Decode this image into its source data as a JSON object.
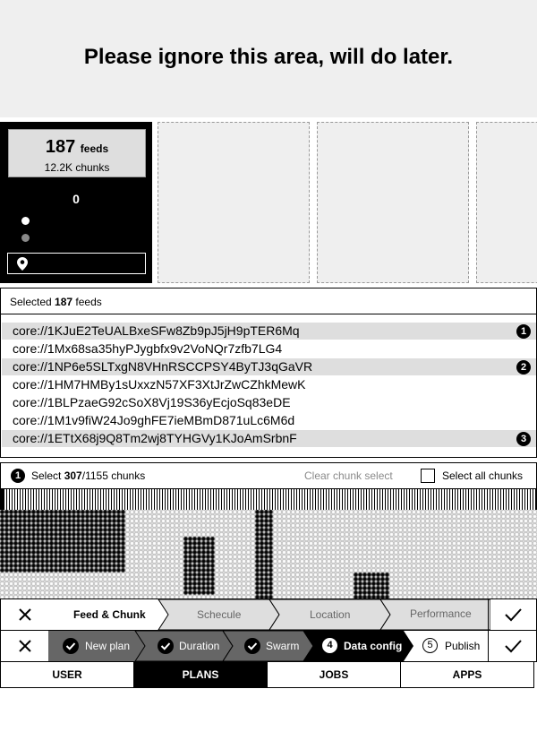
{
  "banner": {
    "text": "Please ignore this area, will do later."
  },
  "feed_summary": {
    "count": "187",
    "unit": "feeds",
    "chunks": "12.2K chunks",
    "zero_value": "0"
  },
  "selection": {
    "prefix": "Selected",
    "count": "187",
    "suffix": "feeds"
  },
  "feeds": [
    {
      "id": "core://1KJuE2TeUALBxeSFw8Zb9pJ5jH9pTER6Mq",
      "highlighted": true,
      "badge": "1"
    },
    {
      "id": "core://1Mx68sa35hyPJygbfx9v2VoNQr7zfb7LG4",
      "highlighted": false,
      "badge": ""
    },
    {
      "id": "core://1NP6e5SLTxgN8VHnRSCCPSY4ByTJ3qGaVR",
      "highlighted": true,
      "badge": "2"
    },
    {
      "id": "core://1HM7HMBy1sUxxzN57XF3XtJrZwCZhkMewK",
      "highlighted": false,
      "badge": ""
    },
    {
      "id": "core://1BLPzaeG92cSoX8Vj19S36yEcjoSq83eDE",
      "highlighted": false,
      "badge": ""
    },
    {
      "id": "core://1M1v9fiW24Jo9ghFE7ieMBmD871uLc6M6d",
      "highlighted": false,
      "badge": ""
    },
    {
      "id": "core://1ETtX68j9Q8Tm2wj8TYHGVy1KJoAmSrbnF",
      "highlighted": true,
      "badge": "3"
    }
  ],
  "chunk_select": {
    "badge": "1",
    "label": "Select",
    "selected": "307",
    "total": "/1155 chunks",
    "clear_label": "Clear chunk select",
    "select_all_label": "Select all chunks"
  },
  "steps_row1": [
    {
      "label": "Feed & Chunk",
      "state": "active"
    },
    {
      "label": "Schecule",
      "state": "upcoming"
    },
    {
      "label": "Location",
      "state": "upcoming"
    },
    {
      "label": "Performance",
      "state": "upcoming"
    }
  ],
  "steps_row2": [
    {
      "label": "New plan",
      "state": "done"
    },
    {
      "label": "Duration",
      "state": "done"
    },
    {
      "label": "Swarm",
      "state": "done"
    },
    {
      "label": "Data config",
      "state": "current",
      "number": "4"
    },
    {
      "label": "Publish",
      "state": "next",
      "number": "5"
    }
  ],
  "nav_tabs": [
    {
      "label": "USER",
      "active": false
    },
    {
      "label": "PLANS",
      "active": true
    },
    {
      "label": "JOBS",
      "active": false
    },
    {
      "label": "APPS",
      "active": false
    }
  ],
  "colors": {
    "active_fill": "#000000",
    "done_fill": "#666666",
    "upcoming_fill": "#dedede",
    "highlight_row": "#dedede",
    "placeholder": "#efefef"
  }
}
